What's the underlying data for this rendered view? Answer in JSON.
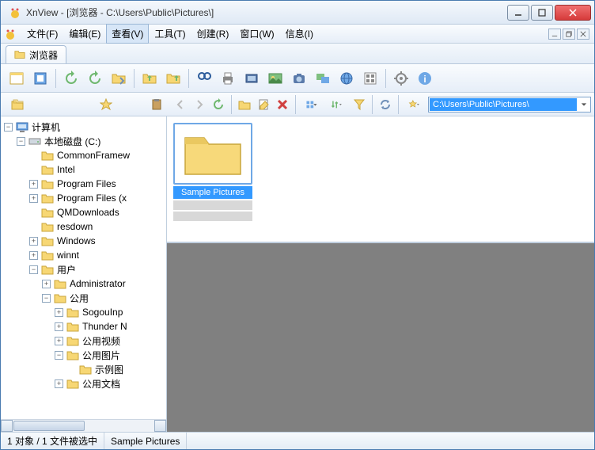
{
  "title": "XnView - [浏览器 - C:\\Users\\Public\\Pictures\\]",
  "menu": {
    "file": "文件(F)",
    "edit": "编辑(E)",
    "view": "查看(V)",
    "tools": "工具(T)",
    "create": "创建(R)",
    "window": "窗口(W)",
    "info": "信息(I)"
  },
  "tab": {
    "label": "浏览器"
  },
  "address": {
    "path": "C:\\Users\\Public\\Pictures\\"
  },
  "tree": {
    "root": "计算机",
    "drive": "本地磁盘 (C:)",
    "n0": "CommonFramew",
    "n1": "Intel",
    "n2": "Program Files",
    "n3": "Program Files (x",
    "n4": "QMDownloads",
    "n5": "resdown",
    "n6": "Windows",
    "n7": "winnt",
    "n8": "用户",
    "n8a": "Administrator",
    "n8b": "公用",
    "n8b0": "SogouInp",
    "n8b1": "Thunder N",
    "n8b2": "公用视频",
    "n8b3": "公用图片",
    "n8b3a": "示例图",
    "n8b4": "公用文档"
  },
  "thumb": {
    "name": "Sample Pictures"
  },
  "status": {
    "left": "1 对象 / 1 文件被选中",
    "right": "Sample Pictures"
  }
}
